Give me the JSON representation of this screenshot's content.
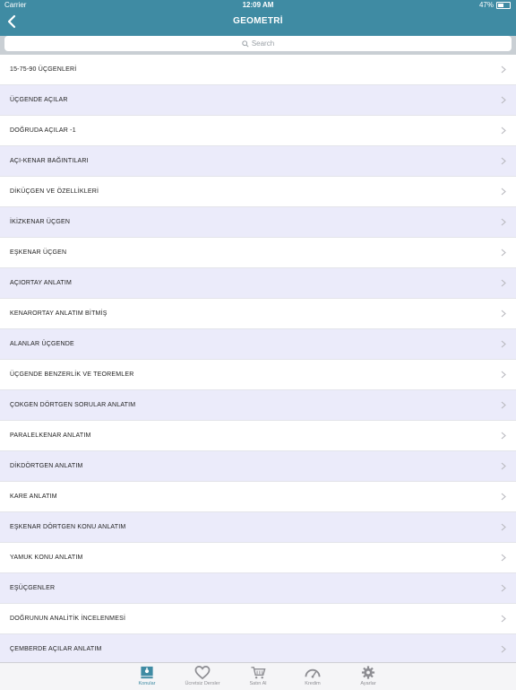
{
  "status_bar": {
    "carrier": "Carrier",
    "time": "12:09 AM",
    "battery": "47%",
    "battery_level": 0.47
  },
  "nav": {
    "title": "GEOMETRİ"
  },
  "search": {
    "placeholder": "Search"
  },
  "topics": [
    "15-75-90 ÜÇGENLERİ",
    "ÜÇGENDE AÇILAR",
    "DOĞRUDA AÇILAR -1",
    "AÇI-KENAR BAĞINTILARI",
    "DİKÜÇGEN VE ÖZELLİKLERİ",
    "İKİZKENAR ÜÇGEN",
    "EŞKENAR ÜÇGEN",
    "AÇIORTAY ANLATIM",
    "KENARORTAY ANLATIM BİTMİŞ",
    "ALANLAR ÜÇGENDE",
    "ÜÇGENDE BENZERLİK VE TEOREMLER",
    "ÇOKGEN DÖRTGEN SORULAR ANLATIM",
    "PARALELKENAR ANLATIM",
    "DİKDÖRTGEN ANLATIM",
    "KARE ANLATIM",
    "EŞKENAR DÖRTGEN KONU ANLATIM",
    "YAMUK KONU ANLATIM",
    "EŞÜÇGENLER",
    "DOĞRUNUN ANALİTİK İNCELENMESİ",
    "ÇEMBERDE AÇILAR ANLATIM"
  ],
  "tabs": [
    {
      "label": "Konular",
      "icon": "topics-icon",
      "active": true
    },
    {
      "label": "Ücretsiz Dersler",
      "icon": "heart-icon",
      "active": false
    },
    {
      "label": "Satın Al",
      "icon": "cart-icon",
      "active": false
    },
    {
      "label": "Kredim",
      "icon": "gauge-icon",
      "active": false
    },
    {
      "label": "Ayarlar",
      "icon": "gear-icon",
      "active": false
    }
  ],
  "colors": {
    "accent": "#3f8ba3",
    "row_alt": "#ebebfa",
    "search_bg": "#c9cfd4"
  }
}
